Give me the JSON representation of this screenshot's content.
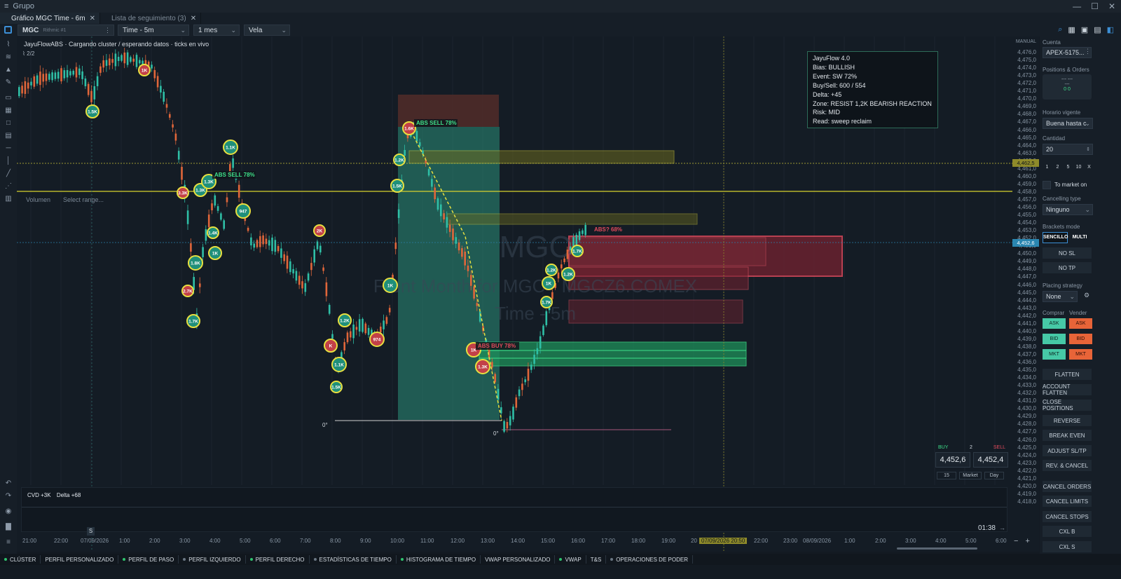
{
  "window": {
    "title": "Grupo"
  },
  "tabs": [
    {
      "label": "Gráfico MGC Time - 6m",
      "active": true
    },
    {
      "label": "Lista de seguimiento (3)",
      "active": false
    }
  ],
  "toolbar": {
    "symbol": "MGC",
    "account_hint": "Rithmic #1",
    "timeframe": "Time - 5m",
    "range": "1 mes",
    "style": "Vela"
  },
  "chart": {
    "status_text": "JayuFlowABS · Cargando cluster / esperando datos · ticks en vivo",
    "page_count": "2/2",
    "volume_label": "Volumen",
    "select_range": "Select range...",
    "watermark_symbol": "MGC",
    "watermark_desc": "Front Month for MGC - MGCZ6.COMEX",
    "watermark_tf": "Time - 5m",
    "cvd": "CVD +3K",
    "delta_text": "Delta +68",
    "clock": "01:38",
    "axis_mode": "MANUAL",
    "current_price": "4,452,6",
    "marker_price": "4,462,5",
    "price_labels": [
      "4,476,0",
      "4,475,0",
      "4,474,0",
      "4,473,0",
      "4,472,0",
      "4,471,0",
      "4,470,0",
      "4,469,0",
      "4,468,0",
      "4,467,0",
      "4,466,0",
      "4,465,0",
      "4,464,0",
      "4,463,0",
      "4,462,0",
      "4,461,0",
      "4,460,0",
      "4,459,0",
      "4,458,0",
      "4,457,0",
      "4,456,0",
      "4,455,0",
      "4,454,0",
      "4,453,0",
      "4,452,0",
      "4,451,0",
      "4,450,0",
      "4,449,0",
      "4,448,0",
      "4,447,0",
      "4,446,0",
      "4,445,0",
      "4,444,0",
      "4,443,0",
      "4,442,0",
      "4,441,0",
      "4,440,0",
      "4,439,0",
      "4,438,0",
      "4,437,0",
      "4,436,0",
      "4,435,0",
      "4,434,0",
      "4,433,0",
      "4,432,0",
      "4,431,0",
      "4,430,0",
      "4,429,0",
      "4,428,0",
      "4,427,0",
      "4,426,0",
      "4,425,0",
      "4,424,0",
      "4,423,0",
      "4,422,0",
      "4,421,0",
      "4,420,0",
      "4,419,0",
      "4,418,0"
    ],
    "time_labels": [
      "21:00",
      "22:00",
      "07/09/2026",
      "1:00",
      "2:00",
      "3:00",
      "4:00",
      "5:00",
      "6:00",
      "7:00",
      "8:00",
      "9:00",
      "10:00",
      "11:00",
      "12:00",
      "13:00",
      "14:00",
      "15:00",
      "16:00",
      "17:00",
      "18:00",
      "19:00",
      "20",
      "07/09/2026 20:50",
      "22:00",
      "23:00",
      "08/09/2026",
      "1:00",
      "2:00",
      "3:00",
      "4:00",
      "5:00",
      "6:00"
    ],
    "annotations": {
      "abs_sell_1": "ABS SELL 78%",
      "abs_sell_2": "ABS SELL 78%",
      "abs_buy": "ABS BUY 78%",
      "abs_q": "ABS? 68%",
      "zero_1": "0°",
      "zero_2": "0°"
    },
    "bubbles": [
      "1K",
      "1.5K",
      "1.1K",
      "3.3K",
      "1.3K",
      "1.3K",
      "1.4K",
      "1K",
      "1.8K",
      "2.7K",
      "1.7K",
      "947",
      "2K",
      "1.2K",
      "1.1K",
      "1.5K",
      "K",
      "974",
      "1.2K",
      "1.5K",
      "1K",
      "1.7K",
      "1K",
      "1.3K",
      "1.2K",
      "1.2K",
      "1K",
      "1.7K",
      "1.6K"
    ]
  },
  "infobox": {
    "lines": [
      "JayuFlow 4.0",
      "Bias: BULLISH",
      "Event: SW 72%",
      "Buy/Sell: 600 / 554",
      "Delta: +45",
      "Zone: RESIST 1,2K BEARISH REACTION",
      "Risk: MID",
      "Read: sweep reclaim"
    ]
  },
  "quote": {
    "buy_label": "BUY",
    "qty": "2",
    "sell_label": "SELL",
    "bid": "4,452,6",
    "ask": "4,452,4",
    "opt1": "15",
    "opt2": "Market",
    "opt3": "Day"
  },
  "panel": {
    "cuenta_label": "Cuenta",
    "account": "APEX-5175...",
    "positions_label": "Positions & Orders",
    "pos_line1": "--- ---",
    "pos_line2": "---",
    "pos_line3": "0 0",
    "horario_label": "Horario vigente",
    "horario_value": "Buena hasta c",
    "cantidad_label": "Cantidad",
    "cantidad_value": "20",
    "qty_buttons": [
      "1",
      "2",
      "5",
      "10",
      "X"
    ],
    "to_market": "To market on",
    "cancelling_label": "Cancelling type",
    "cancelling_value": "Ninguno",
    "brackets_label": "Brackets mode",
    "sencillo": "SENCILLO",
    "multi": "MULTI",
    "no_sl": "NO SL",
    "no_tp": "NO TP",
    "placing_label": "Placing strategy",
    "placing_value": "None",
    "comprar": "Comprar",
    "vender": "Vender",
    "ask": "ASK",
    "bid": "BID",
    "mkt": "MKT",
    "actions": [
      "FLATTEN",
      "ACCOUNT FLATTEN",
      "CLOSE POSITIONS",
      "REVERSE",
      "BREAK EVEN",
      "ADJUST SL/TP",
      "REV. & CANCEL",
      "CANCEL ORDERS",
      "CANCEL LIMITS",
      "CANCEL STOPS",
      "CXL B",
      "CXL S"
    ]
  },
  "bottom": [
    {
      "label": "CLÚSTER",
      "on": true
    },
    {
      "label": "PERFIL PERSONALIZADO",
      "on": null
    },
    {
      "label": "PERFIL DE PASO",
      "on": true
    },
    {
      "label": "PERFIL IZQUIERDO",
      "on": false
    },
    {
      "label": "PERFIL DERECHO",
      "on": true
    },
    {
      "label": "ESTADÍSTICAS DE TIEMPO",
      "on": false
    },
    {
      "label": "HISTOGRAMA DE TIEMPO",
      "on": true
    },
    {
      "label": "VWAP PERSONALIZADO",
      "on": null
    },
    {
      "label": "VWAP",
      "on": true
    },
    {
      "label": "T&S",
      "on": null
    },
    {
      "label": "OPERACIONES DE PODER",
      "on": false
    }
  ]
}
